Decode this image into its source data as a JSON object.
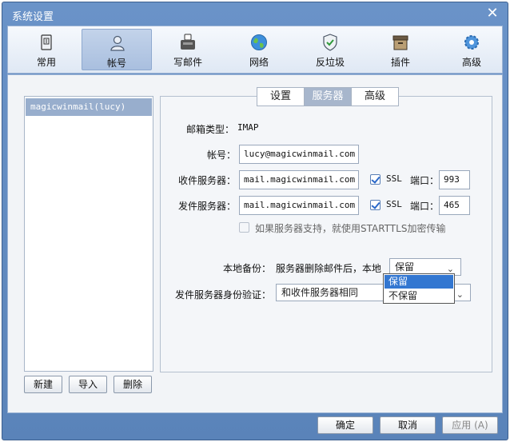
{
  "window": {
    "title": "系统设置",
    "close_glyph": "✕"
  },
  "toolbar": {
    "items": [
      {
        "label": "常用",
        "icon": "general-icon"
      },
      {
        "label": "帐号",
        "icon": "account-icon"
      },
      {
        "label": "写邮件",
        "icon": "compose-icon"
      },
      {
        "label": "网络",
        "icon": "network-icon"
      },
      {
        "label": "反垃圾",
        "icon": "antispam-icon"
      },
      {
        "label": "插件",
        "icon": "plugin-icon"
      },
      {
        "label": "高级",
        "icon": "advanced-icon"
      }
    ],
    "active_index": 1
  },
  "accounts": {
    "items": [
      "magicwinmail(lucy)"
    ],
    "selected_index": 0,
    "buttons": {
      "new": "新建",
      "import": "导入",
      "delete": "删除"
    }
  },
  "tabs": {
    "items": [
      "设置",
      "服务器",
      "高级"
    ],
    "active_index": 1
  },
  "server": {
    "type_label": "邮箱类型：",
    "type_value": "IMAP",
    "account_label": "帐号：",
    "account_value": "lucy@magicwinmail.com",
    "incoming_label": "收件服务器：",
    "incoming_value": "mail.magicwinmail.com",
    "incoming_ssl": true,
    "incoming_ssl_label": "SSL",
    "incoming_port_label": "端口：",
    "incoming_port": "993",
    "outgoing_label": "发件服务器：",
    "outgoing_value": "mail.magicwinmail.com",
    "outgoing_ssl": true,
    "outgoing_ssl_label": "SSL",
    "outgoing_port_label": "端口：",
    "outgoing_port": "465",
    "starttls_label": "如果服务器支持，就使用STARTTLS加密传输",
    "starttls_checked": false,
    "backup_label": "本地备份：",
    "backup_desc": "服务器删除邮件后，本地",
    "backup_value": "保留",
    "backup_options": [
      "保留",
      "不保留"
    ],
    "auth_label": "发件服务器身份验证：",
    "auth_value": "和收件服务器相同"
  },
  "footer": {
    "ok": "确定",
    "cancel": "取消",
    "apply": "应用 (A)"
  },
  "colors": {
    "accent": "#3377d1",
    "titlebar": "#6a93c8",
    "selected_account": "#98aecd"
  }
}
